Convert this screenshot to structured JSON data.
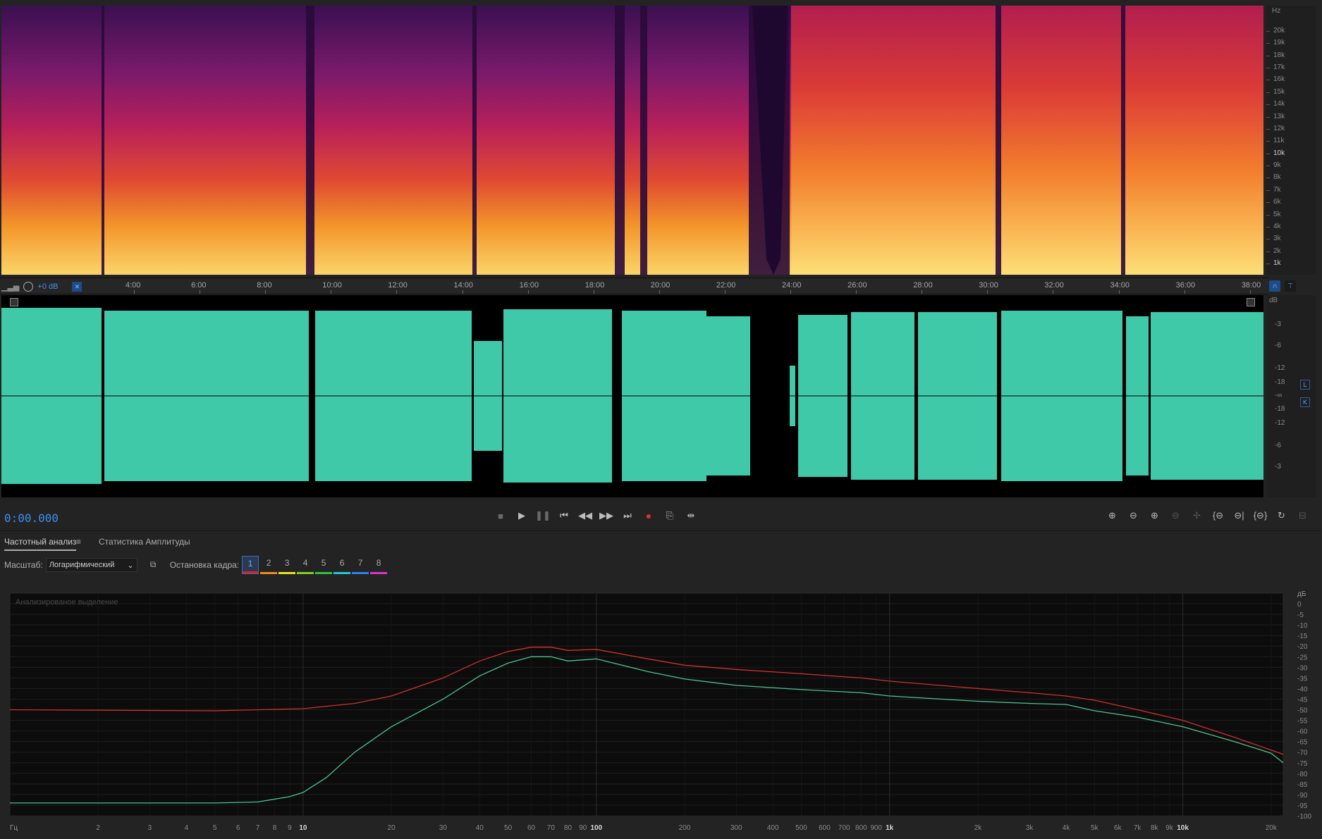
{
  "spectrogram": {
    "unit": "Hz",
    "freq_labels": [
      "20k",
      "19k",
      "18k",
      "17k",
      "16k",
      "15k",
      "14k",
      "13k",
      "12k",
      "11k",
      "10k",
      "9k",
      "8k",
      "7k",
      "6k",
      "5k",
      "4k",
      "3k",
      "2k",
      "1k"
    ]
  },
  "timeline": {
    "gain": "+0 dB",
    "labels": [
      "4:00",
      "6:00",
      "8:00",
      "10:00",
      "12:00",
      "14:00",
      "16:00",
      "18:00",
      "20:00",
      "22:00",
      "24:00",
      "26:00",
      "28:00",
      "30:00",
      "32:00",
      "34:00",
      "36:00",
      "38:00"
    ]
  },
  "waveform": {
    "unit": "dB",
    "db_labels": [
      "-3",
      "-6",
      "-12",
      "-18",
      "-∞",
      "-18",
      "-12",
      "-6",
      "-3"
    ],
    "channels": [
      "L",
      "K"
    ],
    "color": "#3fc9a8"
  },
  "transport": {
    "time": "0:00.000",
    "buttons": [
      "stop-icon",
      "play-icon",
      "pause-icon",
      "skip-start-icon",
      "rewind-icon",
      "fast-forward-icon",
      "skip-end-icon",
      "record-icon",
      "loop-icon",
      "skip-selection-icon"
    ]
  },
  "panel": {
    "tab_freq": "Частотный анализ",
    "tab_amp": "Статистика Амплитуды",
    "scale_label": "Масштаб:",
    "scale_value": "Логарифмический",
    "hold_label": "Остановка кадра:",
    "holds": [
      {
        "label": "1",
        "color": "#e02020"
      },
      {
        "label": "2",
        "color": "#f08a20"
      },
      {
        "label": "3",
        "color": "#e8e020"
      },
      {
        "label": "4",
        "color": "#80d020"
      },
      {
        "label": "5",
        "color": "#30c040"
      },
      {
        "label": "6",
        "color": "#20c8d8"
      },
      {
        "label": "7",
        "color": "#2a80f0"
      },
      {
        "label": "8",
        "color": "#e030d0"
      }
    ]
  },
  "chart_data": {
    "type": "line",
    "title": "Анализированое выделение",
    "x_unit": "Гц",
    "y_unit": "дБ",
    "x_scale": "log",
    "x_tick_labels": [
      "2",
      "3",
      "4",
      "5",
      "6",
      "7",
      "8",
      "9",
      "10",
      "20",
      "30",
      "40",
      "50",
      "60",
      "70",
      "80",
      "90",
      "100",
      "200",
      "300",
      "400",
      "500",
      "600",
      "700",
      "800",
      "900",
      "1k",
      "2k",
      "3k",
      "4k",
      "5k",
      "6k",
      "7k",
      "8k",
      "9k",
      "10k",
      "20k"
    ],
    "y_tick_labels": [
      "0",
      "-5",
      "-10",
      "-15",
      "-20",
      "-25",
      "-30",
      "-35",
      "-40",
      "-45",
      "-50",
      "-55",
      "-60",
      "-65",
      "-70",
      "-75",
      "-80",
      "-85",
      "-90",
      "-95",
      "-100"
    ],
    "xlim": [
      1,
      22000
    ],
    "ylim": [
      -100,
      5
    ],
    "grid": true,
    "series": [
      {
        "color": "#d03030",
        "x": [
          1,
          5,
          10,
          15,
          20,
          30,
          40,
          50,
          60,
          70,
          80,
          100,
          150,
          200,
          300,
          500,
          800,
          1000,
          2000,
          3000,
          4000,
          5000,
          7000,
          10000,
          15000,
          20000,
          22000
        ],
        "y": [
          -50,
          -50.5,
          -49.5,
          -47,
          -43.5,
          -35,
          -27,
          -22.5,
          -20.5,
          -20.5,
          -22,
          -21.5,
          -26,
          -29,
          -31,
          -33,
          -35,
          -36.5,
          -40,
          -42,
          -43.5,
          -45.5,
          -50,
          -55,
          -63,
          -69,
          -71
        ]
      },
      {
        "color": "#4cc290",
        "x": [
          1,
          5,
          7,
          9,
          10,
          12,
          15,
          20,
          30,
          40,
          50,
          60,
          70,
          80,
          100,
          150,
          200,
          300,
          500,
          800,
          1000,
          2000,
          3000,
          4000,
          5000,
          7000,
          10000,
          15000,
          20000,
          22000
        ],
        "y": [
          -94,
          -94,
          -93.5,
          -91,
          -89,
          -82,
          -70,
          -58,
          -45,
          -34,
          -28,
          -25,
          -25,
          -27,
          -26,
          -32,
          -35.5,
          -38.5,
          -40.5,
          -42,
          -43.5,
          -46,
          -47,
          -47.5,
          -50.5,
          -53.5,
          -58,
          -65,
          -70.5,
          -75
        ]
      }
    ]
  }
}
